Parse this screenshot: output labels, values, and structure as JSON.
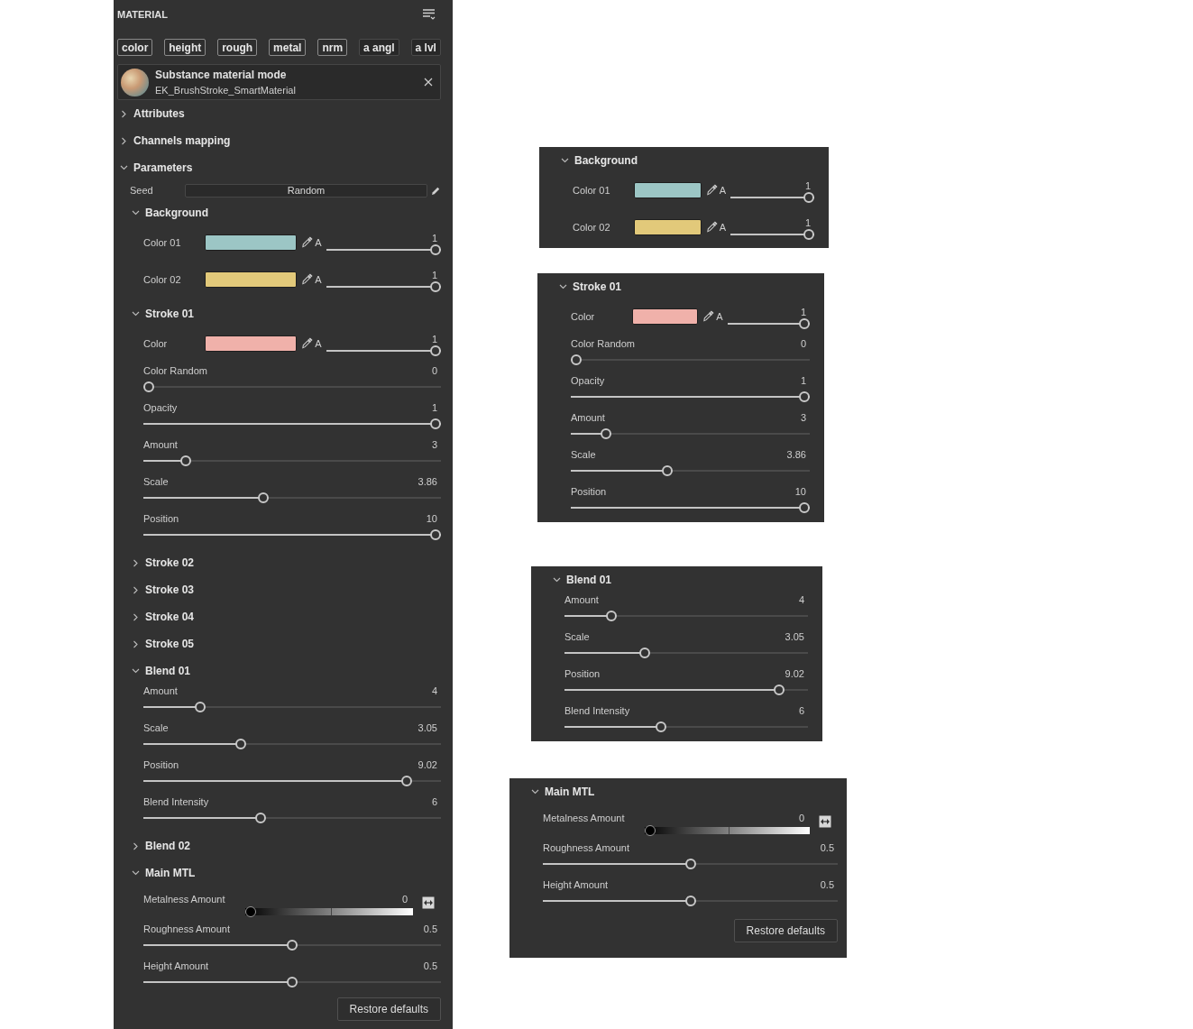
{
  "panel": {
    "title": "MATERIAL",
    "channels": [
      {
        "label": "color",
        "on": true
      },
      {
        "label": "height",
        "on": true
      },
      {
        "label": "rough",
        "on": true
      },
      {
        "label": "metal",
        "on": true
      },
      {
        "label": "nrm",
        "on": true
      },
      {
        "label": "a angl",
        "on": false
      },
      {
        "label": "a lvl",
        "on": false
      }
    ],
    "material": {
      "title": "Substance material mode",
      "name": "EK_BrushStroke_SmartMaterial"
    },
    "sections": [
      {
        "title": "Attributes",
        "expanded": false
      },
      {
        "title": "Channels mapping",
        "expanded": false
      },
      {
        "title": "Parameters",
        "expanded": true,
        "seed": {
          "label": "Seed",
          "value": "Random"
        },
        "groups": [
          {
            "title": "Background",
            "expanded": true,
            "rows": [
              {
                "kind": "color",
                "label": "Color 01",
                "color": "#9cc6c5",
                "alpha": "A",
                "value": "1",
                "level": 1
              },
              {
                "kind": "color",
                "label": "Color 02",
                "color": "#e2c97a",
                "alpha": "A",
                "value": "1",
                "level": 1
              }
            ]
          },
          {
            "title": "Stroke 01",
            "expanded": true,
            "rows": [
              {
                "kind": "color",
                "label": "Color",
                "color": "#f0b1aa",
                "alpha": "A",
                "value": "1",
                "level": 1
              },
              {
                "kind": "slider",
                "label": "Color Random",
                "value": "0",
                "level": 0
              },
              {
                "kind": "slider",
                "label": "Opacity",
                "value": "1",
                "level": 1
              },
              {
                "kind": "slider",
                "label": "Amount",
                "value": "3",
                "level": 0.13
              },
              {
                "kind": "slider",
                "label": "Scale",
                "value": "3.86",
                "level": 0.4
              },
              {
                "kind": "slider",
                "label": "Position",
                "value": "10",
                "level": 1
              }
            ]
          },
          {
            "title": "Stroke 02",
            "expanded": false
          },
          {
            "title": "Stroke 03",
            "expanded": false
          },
          {
            "title": "Stroke 04",
            "expanded": false
          },
          {
            "title": "Stroke 05",
            "expanded": false
          },
          {
            "title": "Blend 01",
            "expanded": true,
            "rows": [
              {
                "kind": "slider",
                "label": "Amount",
                "value": "4",
                "level": 0.18
              },
              {
                "kind": "slider",
                "label": "Scale",
                "value": "3.05",
                "level": 0.32
              },
              {
                "kind": "slider",
                "label": "Position",
                "value": "9.02",
                "level": 0.9
              },
              {
                "kind": "slider",
                "label": "Blend Intensity",
                "value": "6",
                "level": 0.39
              }
            ]
          },
          {
            "title": "Blend 02",
            "expanded": false
          },
          {
            "title": "Main MTL",
            "expanded": true,
            "rows": [
              {
                "kind": "gradient",
                "label": "Metalness Amount",
                "value": "0",
                "level": 0
              },
              {
                "kind": "slider",
                "label": "Roughness Amount",
                "value": "0.5",
                "level": 0.5
              },
              {
                "kind": "slider",
                "label": "Height Amount",
                "value": "0.5",
                "level": 0.5
              }
            ]
          }
        ]
      }
    ],
    "restore_button": "Restore defaults"
  },
  "callouts": [
    {
      "title": "Background",
      "expanded": true,
      "rows": [
        {
          "kind": "color",
          "label": "Color 01",
          "color": "#9cc6c5",
          "alpha": "A",
          "value": "1",
          "level": 1
        },
        {
          "kind": "color",
          "label": "Color 02",
          "color": "#e2c97a",
          "alpha": "A",
          "value": "1",
          "level": 1
        }
      ]
    },
    {
      "title": "Stroke 01",
      "expanded": true,
      "rows": [
        {
          "kind": "color",
          "label": "Color",
          "color": "#f0b1aa",
          "alpha": "A",
          "value": "1",
          "level": 1
        },
        {
          "kind": "slider",
          "label": "Color Random",
          "value": "0",
          "level": 0
        },
        {
          "kind": "slider",
          "label": "Opacity",
          "value": "1",
          "level": 1
        },
        {
          "kind": "slider",
          "label": "Amount",
          "value": "3",
          "level": 0.13
        },
        {
          "kind": "slider",
          "label": "Scale",
          "value": "3.86",
          "level": 0.4
        },
        {
          "kind": "slider",
          "label": "Position",
          "value": "10",
          "level": 1
        }
      ]
    },
    {
      "title": "Blend 01",
      "expanded": true,
      "rows": [
        {
          "kind": "slider",
          "label": "Amount",
          "value": "4",
          "level": 0.18
        },
        {
          "kind": "slider",
          "label": "Scale",
          "value": "3.05",
          "level": 0.32
        },
        {
          "kind": "slider",
          "label": "Position",
          "value": "9.02",
          "level": 0.9
        },
        {
          "kind": "slider",
          "label": "Blend Intensity",
          "value": "6",
          "level": 0.39
        }
      ]
    },
    {
      "title": "Main MTL",
      "expanded": true,
      "rows": [
        {
          "kind": "gradient",
          "label": "Metalness Amount",
          "value": "0",
          "level": 0
        },
        {
          "kind": "slider",
          "label": "Roughness Amount",
          "value": "0.5",
          "level": 0.5
        },
        {
          "kind": "slider",
          "label": "Height Amount",
          "value": "0.5",
          "level": 0.5
        }
      ],
      "restore_button": "Restore defaults"
    }
  ]
}
